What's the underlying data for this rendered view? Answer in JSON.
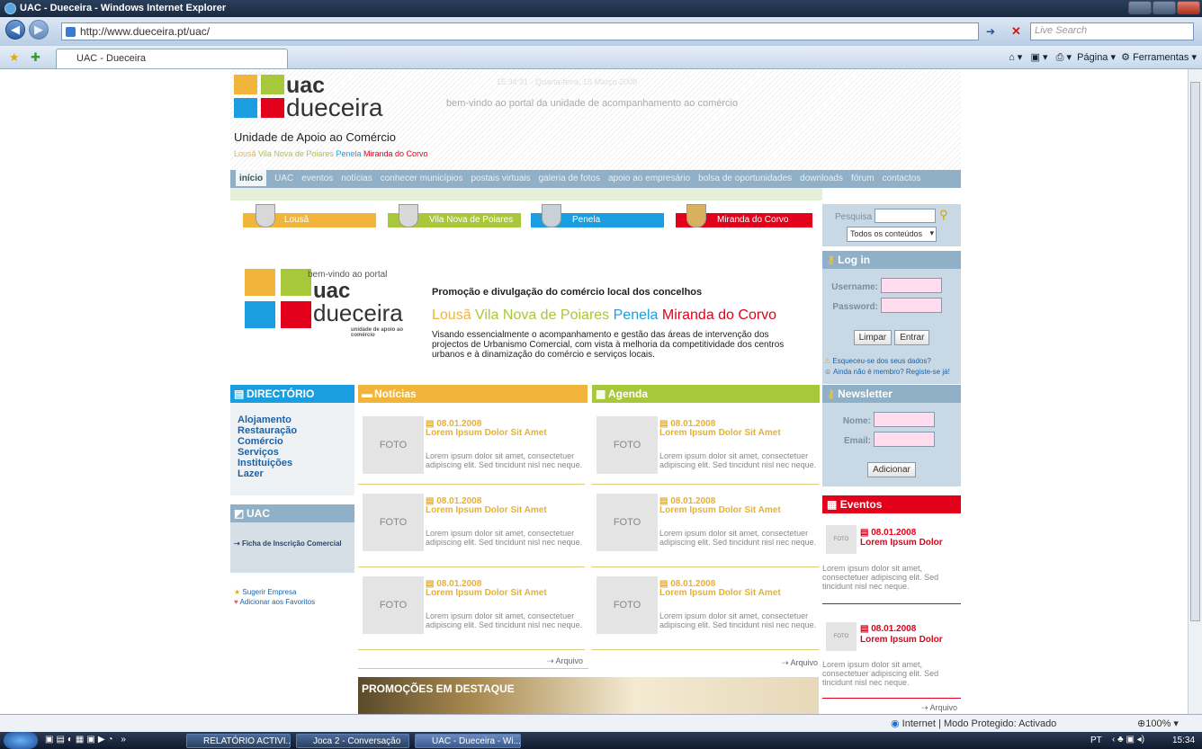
{
  "window": {
    "title": "UAC - Dueceira - Windows Internet Explorer"
  },
  "address": {
    "url": "http://www.dueceira.pt/uac/",
    "search_placeholder": "Live Search"
  },
  "tab": {
    "label": "UAC - Dueceira"
  },
  "toolbar": {
    "pagina": "Página",
    "ferramentas": "Ferramentas"
  },
  "site": {
    "logo_uac": "uac",
    "logo_dueceira": "dueceira",
    "subtitle": "Unidade de Apoio ao Comércio",
    "places": [
      "Lousã",
      "Vila Nova de Poiares",
      "Penela",
      "Miranda do Corvo"
    ],
    "datetime": "15:34:31 - Quarta-feira, 18 Março 2009",
    "welcome": "bem-vindo ao portal da unidade de acompanhamento ao comércio",
    "nav": [
      "início",
      "UAC",
      "eventos",
      "notícias",
      "conhecer municípios",
      "postais virtuais",
      "galeria de fotos",
      "apoio ao empresário",
      "bolsa de oportunidades",
      "downloads",
      "fórum",
      "contactos"
    ],
    "municipios": [
      "Lousã",
      "Vila Nova de Poiares",
      "Penela",
      "Miranda do Corvo"
    ],
    "banner": {
      "welcome": "bem-vindo ao portal",
      "uac": "uac",
      "dueceira": "dueceira",
      "small": "unidade de apoio ao comércio",
      "headline": "Promoção e divulgação do comércio local dos concelhos",
      "places": [
        "Lousã",
        "Vila Nova de Poiares",
        "Penela",
        "Miranda do Corvo"
      ],
      "text": "Visando essencialmente o acompanhamento e gestão das áreas de intervenção dos projectos de Urbanismo Comercial, com vista à melhoria da competitividade dos centros urbanos e à dinamização do comércio e serviços locais."
    },
    "search": {
      "label": "Pesquisa",
      "select": "Todos os conteúdos"
    },
    "login": {
      "title": "Log in",
      "username": "Username:",
      "password": "Password:",
      "clear": "Limpar",
      "enter": "Entrar",
      "forgot": "Esqueceu-se dos seus dados?",
      "register": "Ainda não é membro? Registe-se já!"
    },
    "newsletter": {
      "title": "Newsletter",
      "name": "Nome:",
      "email": "Email:",
      "add": "Adicionar"
    },
    "eventos": {
      "title": "Eventos",
      "date": "08.01.2008",
      "item_title": "Lorem Ipsum Dolor",
      "text": "Lorem ipsum dolor sit amet, consectetuer adipiscing elit. Sed tincidunt nisl nec neque.",
      "foto": "FOTO",
      "archive": "Arquivo"
    },
    "directorio": {
      "title": "DIRECTÓRIO",
      "items": [
        "Alojamento",
        "Restauração",
        "Comércio",
        "Serviços",
        "Instituições",
        "Lazer"
      ]
    },
    "uac_box": {
      "title": "UAC",
      "link": "Ficha de Inscrição Comercial"
    },
    "extras": {
      "suggest": "Sugerir Empresa",
      "favorites": "Adicionar aos Favoritos"
    },
    "noticias": {
      "title": "Notícias"
    },
    "agenda": {
      "title": "Agenda"
    },
    "card": {
      "foto": "FOTO",
      "date": "08.01.2008",
      "title": "Lorem Ipsum Dolor Sit Amet",
      "text": "Lorem ipsum dolor sit amet, consectetuer adipiscing elit. Sed tincidunt nisl nec neque."
    },
    "archive": "Arquivo",
    "promo": "PROMOÇÕES EM DESTAQUE"
  },
  "status": {
    "text": "Internet | Modo Protegido: Activado",
    "zoom": "100%"
  },
  "taskbar": {
    "items": [
      "RELATÓRIO ACTIVI...",
      "Joca 2 - Conversação",
      "UAC - Dueceira - Wi..."
    ],
    "lang": "PT",
    "time": "15:34"
  },
  "colors": {
    "orange": "#f0b53a",
    "green": "#a8c83c",
    "blue": "#1a9ee0",
    "red": "#e2001a",
    "steel": "#8fb0c6"
  }
}
